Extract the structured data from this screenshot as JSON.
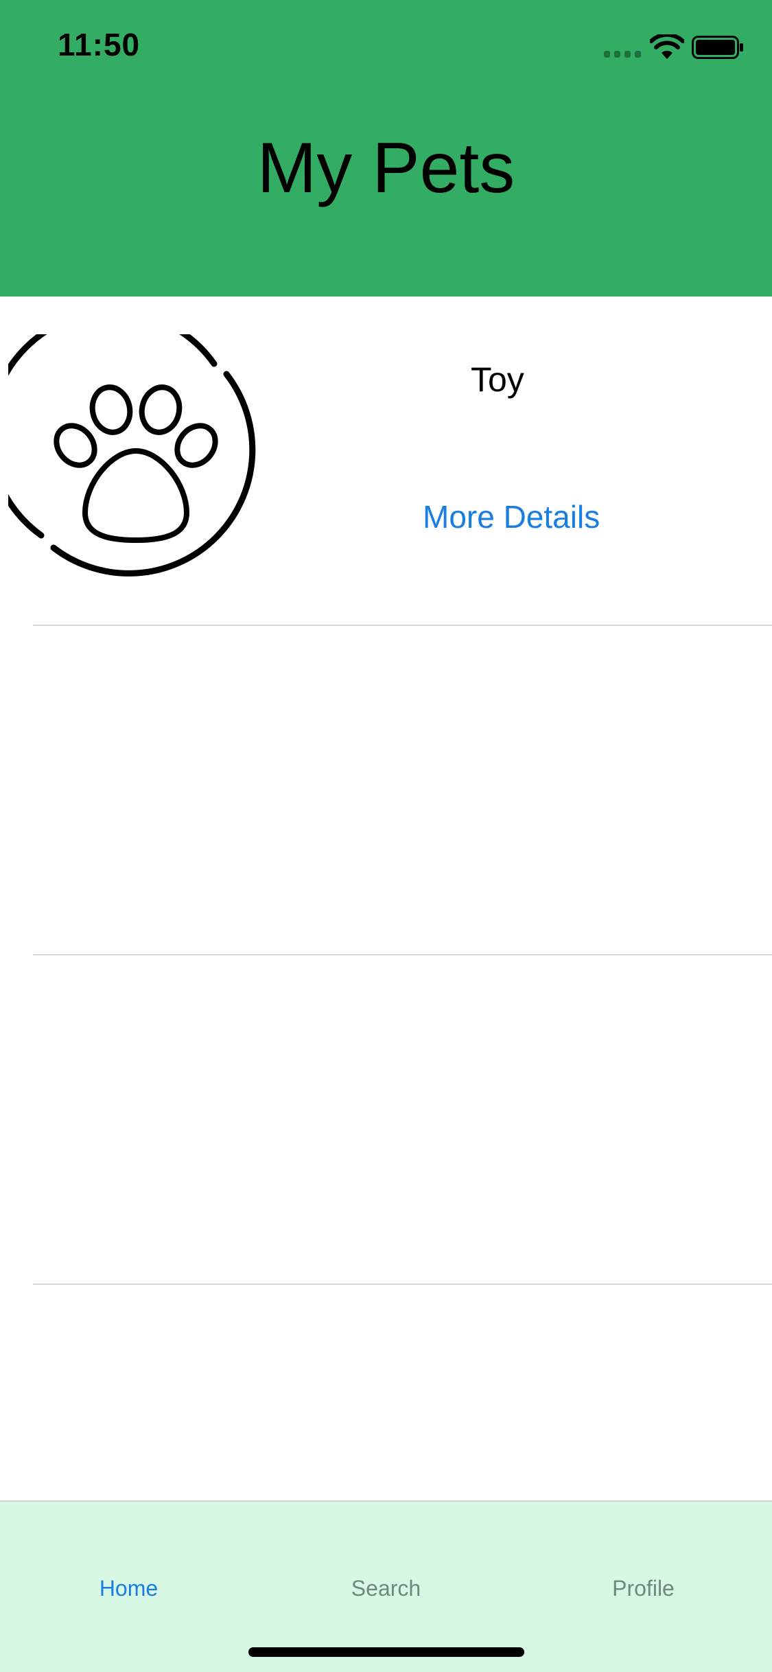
{
  "status_bar": {
    "time": "11:50"
  },
  "header": {
    "title": "My Pets",
    "background_color": "#33ad63"
  },
  "pets": [
    {
      "name": "Toy",
      "avatar_icon": "paw-circle-icon",
      "details_label": "More Details"
    }
  ],
  "tab_bar": {
    "background_color": "#d8f8e6",
    "active_color": "#1a7ee0",
    "inactive_color": "#6e8a7b",
    "tabs": [
      {
        "label": "Home",
        "active": true
      },
      {
        "label": "Search",
        "active": false
      },
      {
        "label": "Profile",
        "active": false
      }
    ]
  }
}
